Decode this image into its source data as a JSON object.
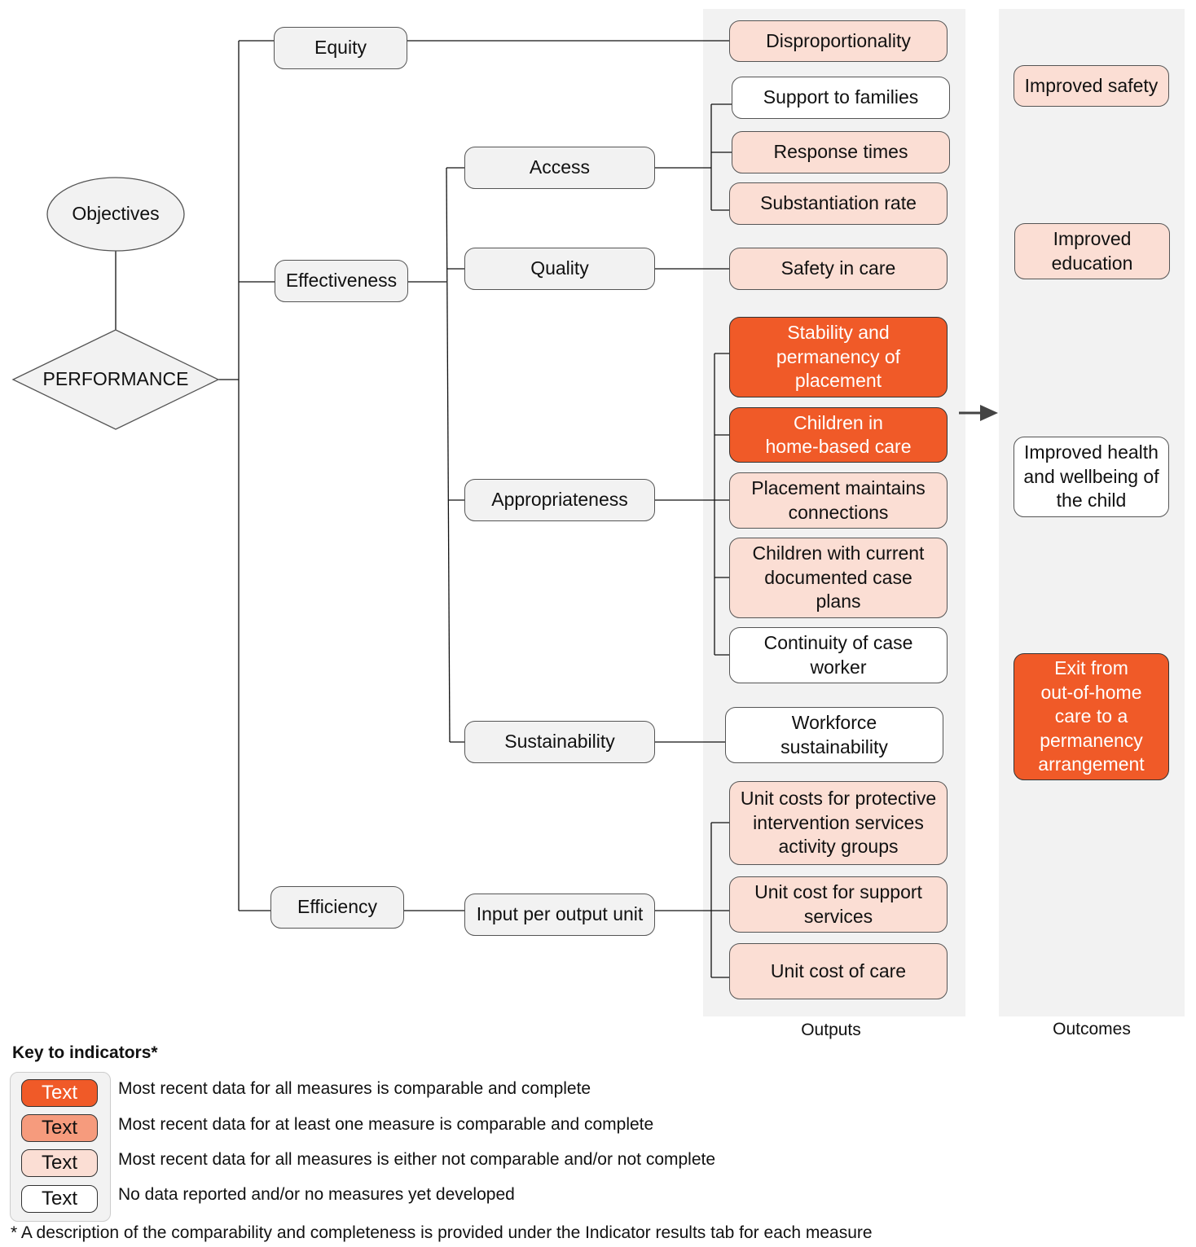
{
  "colors": {
    "complete": "#f05a28",
    "partial": "#f69b7d",
    "incomplete": "#fbded4",
    "none": "#ffffff",
    "framework_box": "#f2f2f2",
    "panel": "#f2f2f2"
  },
  "framework": {
    "objectives": "Objectives",
    "performance": "PERFORMANCE",
    "dimensions": {
      "equity": "Equity",
      "effectiveness": "Effectiveness",
      "efficiency": "Efficiency"
    },
    "subdimensions": {
      "access": "Access",
      "quality": "Quality",
      "appropriateness": "Appropriateness",
      "sustainability": "Sustainability",
      "input_per_output": "Input per output unit"
    }
  },
  "outputs": {
    "label": "Outputs",
    "indicators": [
      {
        "id": "disproportionality",
        "text": "Disproportionality",
        "status": "incomplete"
      },
      {
        "id": "support-to-families",
        "text": "Support to families",
        "status": "none"
      },
      {
        "id": "response-times",
        "text": "Response times",
        "status": "incomplete"
      },
      {
        "id": "substantiation-rate",
        "text": "Substantiation rate",
        "status": "incomplete"
      },
      {
        "id": "safety-in-care",
        "text": "Safety in care",
        "status": "incomplete"
      },
      {
        "id": "stability-permanency",
        "text": "Stability and\npermanency of\nplacement",
        "status": "complete"
      },
      {
        "id": "home-based-care",
        "text": "Children in\nhome-based care",
        "status": "complete"
      },
      {
        "id": "placement-connections",
        "text": "Placement maintains\nconnections",
        "status": "incomplete"
      },
      {
        "id": "case-plans",
        "text": "Children with current\ndocumented case\nplans",
        "status": "incomplete"
      },
      {
        "id": "continuity-case-worker",
        "text": "Continuity of case\nworker",
        "status": "none"
      },
      {
        "id": "workforce-sustainability",
        "text": "Workforce\nsustainability",
        "status": "none"
      },
      {
        "id": "unit-costs-protective",
        "text": "Unit costs for protective\nintervention services\nactivity groups",
        "status": "incomplete"
      },
      {
        "id": "unit-cost-support",
        "text": "Unit cost for support\nservices",
        "status": "incomplete"
      },
      {
        "id": "unit-cost-care",
        "text": "Unit cost of care",
        "status": "incomplete"
      }
    ]
  },
  "outcomes": {
    "label": "Outcomes",
    "indicators": [
      {
        "id": "improved-safety",
        "text": "Improved safety",
        "status": "incomplete"
      },
      {
        "id": "improved-education",
        "text": "Improved\neducation",
        "status": "incomplete"
      },
      {
        "id": "improved-health",
        "text": "Improved health\nand wellbeing of\nthe child",
        "status": "none"
      },
      {
        "id": "exit-ohc",
        "text": "Exit from\nout-of-home\ncare to a\npermanency\narrangement",
        "status": "complete"
      }
    ]
  },
  "key": {
    "title": "Key to indicators*",
    "chip_label": "Text",
    "items": [
      {
        "status": "complete",
        "text": "Most recent data for all measures is comparable and complete"
      },
      {
        "status": "partial",
        "text": "Most recent data for at least one measure is comparable and complete"
      },
      {
        "status": "incomplete",
        "text": "Most recent data for all measures is either not comparable and/or not complete"
      },
      {
        "status": "none",
        "text": "No data reported and/or no measures yet developed"
      }
    ],
    "footnote": "* A description of the comparability and completeness is provided under the Indicator results tab for each measure"
  }
}
